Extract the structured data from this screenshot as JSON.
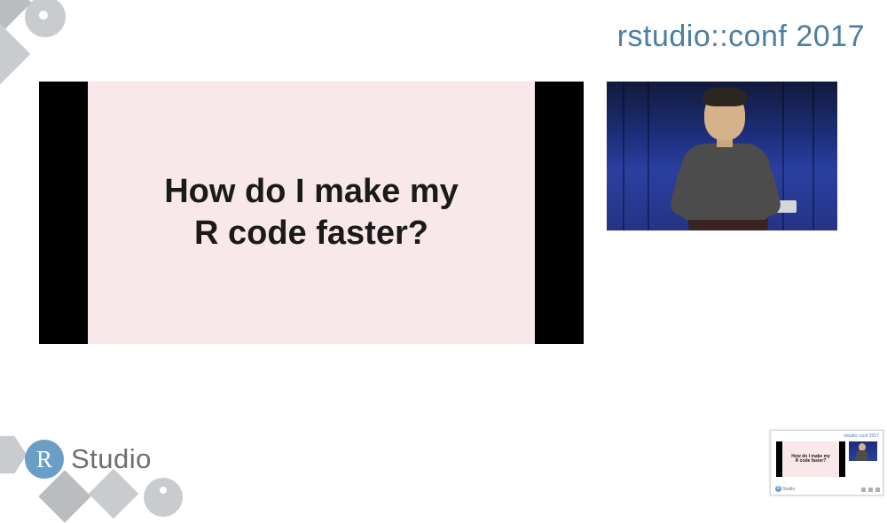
{
  "header": {
    "label": "rstudio::conf 2017"
  },
  "slide": {
    "line1": "How do I make my",
    "line2": "R code faster?"
  },
  "logo": {
    "letter": "R",
    "text": "Studio"
  },
  "thumbnail": {
    "header": "rstudio::conf 2017",
    "slide_line1": "How do I make my",
    "slide_line2": "R code faster?",
    "logo_letter": "R",
    "logo_text": "Studio"
  }
}
